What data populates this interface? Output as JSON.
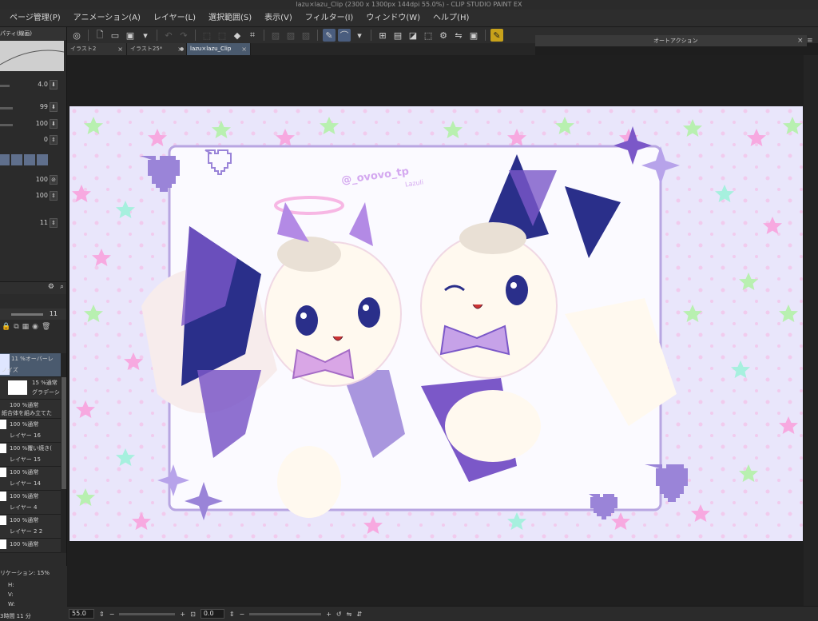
{
  "window": {
    "title": "lazu×lazu_Clip (2300 x 1300px 144dpi 55.0%) - CLIP STUDIO PAINT EX"
  },
  "menu": [
    "ページ管理(P)",
    "アニメーション(A)",
    "レイヤー(L)",
    "選択範囲(S)",
    "表示(V)",
    "フィルター(I)",
    "ウィンドウ(W)",
    "ヘルプ(H)"
  ],
  "tabs": [
    {
      "label": "イラスト2",
      "close": "×"
    },
    {
      "label": "イラスト25*",
      "close": "×"
    },
    {
      "label": "lazu×lazu_Clip",
      "close": "×"
    }
  ],
  "tab_bullet": "●",
  "auto_action": {
    "title": "オートアクション",
    "close": "×",
    "menu": "≡"
  },
  "property_panel": {
    "title": "パティ(線画)",
    "values": [
      "4.0",
      "99",
      "100",
      "0",
      "100",
      "100",
      "11"
    ]
  },
  "layer_panel": {
    "opacity_value": "11",
    "layers": [
      {
        "blend": "11 %オーバーレ",
        "name": "ノイズ"
      },
      {
        "blend": "15 %通常",
        "name": "グラデーショ"
      },
      {
        "blend": "100 %通常",
        "name": "紙合体を組み立てた"
      },
      {
        "blend": "100 %通常",
        "name": "レイヤー 16"
      },
      {
        "blend": "100 %覆い焼き(",
        "name": "レイヤー 15"
      },
      {
        "blend": "100 %通常",
        "name": "レイヤー 14"
      },
      {
        "blend": "100 %通常",
        "name": "レイヤー 4"
      },
      {
        "blend": "100 %通常",
        "name": "レイヤー 2 2"
      },
      {
        "blend": "100 %通常",
        "name": ""
      }
    ]
  },
  "navigator": {
    "label": "リケーション: 15%",
    "h": "H:",
    "v": "V:",
    "w": "W:",
    "time": "3時間 11 分"
  },
  "status": {
    "zoom": "55.0",
    "rotation": "0.0",
    "minus": "−",
    "plus": "+"
  },
  "canvas": {
    "signature": "@_ovovo_tp",
    "signature2": "Lazuli"
  },
  "colors": {
    "canvas_bg": "#e9e6fb",
    "frame": "#b8a6e2",
    "star_pink": "#f7a9e0",
    "star_green": "#b8f0b0",
    "star_aqua": "#a6f0de",
    "heart_purple": "#9a84d8",
    "bat_navy": "#2a2f8a",
    "bat_purple": "#7b58c8",
    "fur": "#fff9ef",
    "ribbon": "#d9a6e6",
    "active_tab": "#4a5a6e"
  },
  "icons": [
    "undo-icon",
    "redo-icon",
    "new-file-icon",
    "open-icon",
    "save-icon",
    "pen-icon",
    "ruler-icon",
    "selection-icon",
    "layer-icon"
  ]
}
